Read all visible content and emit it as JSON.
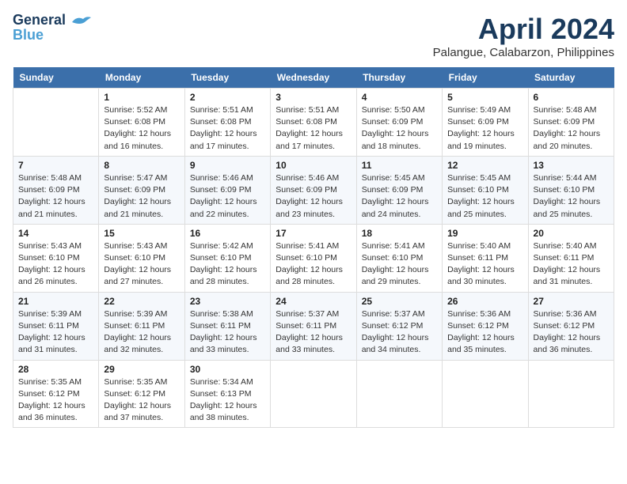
{
  "header": {
    "logo_line1": "General",
    "logo_line2": "Blue",
    "month": "April 2024",
    "location": "Palangue, Calabarzon, Philippines"
  },
  "weekdays": [
    "Sunday",
    "Monday",
    "Tuesday",
    "Wednesday",
    "Thursday",
    "Friday",
    "Saturday"
  ],
  "weeks": [
    [
      {
        "day": "",
        "sunrise": "",
        "sunset": "",
        "daylight": ""
      },
      {
        "day": "1",
        "sunrise": "Sunrise: 5:52 AM",
        "sunset": "Sunset: 6:08 PM",
        "daylight": "Daylight: 12 hours and 16 minutes."
      },
      {
        "day": "2",
        "sunrise": "Sunrise: 5:51 AM",
        "sunset": "Sunset: 6:08 PM",
        "daylight": "Daylight: 12 hours and 17 minutes."
      },
      {
        "day": "3",
        "sunrise": "Sunrise: 5:51 AM",
        "sunset": "Sunset: 6:08 PM",
        "daylight": "Daylight: 12 hours and 17 minutes."
      },
      {
        "day": "4",
        "sunrise": "Sunrise: 5:50 AM",
        "sunset": "Sunset: 6:09 PM",
        "daylight": "Daylight: 12 hours and 18 minutes."
      },
      {
        "day": "5",
        "sunrise": "Sunrise: 5:49 AM",
        "sunset": "Sunset: 6:09 PM",
        "daylight": "Daylight: 12 hours and 19 minutes."
      },
      {
        "day": "6",
        "sunrise": "Sunrise: 5:48 AM",
        "sunset": "Sunset: 6:09 PM",
        "daylight": "Daylight: 12 hours and 20 minutes."
      }
    ],
    [
      {
        "day": "7",
        "sunrise": "Sunrise: 5:48 AM",
        "sunset": "Sunset: 6:09 PM",
        "daylight": "Daylight: 12 hours and 21 minutes."
      },
      {
        "day": "8",
        "sunrise": "Sunrise: 5:47 AM",
        "sunset": "Sunset: 6:09 PM",
        "daylight": "Daylight: 12 hours and 21 minutes."
      },
      {
        "day": "9",
        "sunrise": "Sunrise: 5:46 AM",
        "sunset": "Sunset: 6:09 PM",
        "daylight": "Daylight: 12 hours and 22 minutes."
      },
      {
        "day": "10",
        "sunrise": "Sunrise: 5:46 AM",
        "sunset": "Sunset: 6:09 PM",
        "daylight": "Daylight: 12 hours and 23 minutes."
      },
      {
        "day": "11",
        "sunrise": "Sunrise: 5:45 AM",
        "sunset": "Sunset: 6:09 PM",
        "daylight": "Daylight: 12 hours and 24 minutes."
      },
      {
        "day": "12",
        "sunrise": "Sunrise: 5:45 AM",
        "sunset": "Sunset: 6:10 PM",
        "daylight": "Daylight: 12 hours and 25 minutes."
      },
      {
        "day": "13",
        "sunrise": "Sunrise: 5:44 AM",
        "sunset": "Sunset: 6:10 PM",
        "daylight": "Daylight: 12 hours and 25 minutes."
      }
    ],
    [
      {
        "day": "14",
        "sunrise": "Sunrise: 5:43 AM",
        "sunset": "Sunset: 6:10 PM",
        "daylight": "Daylight: 12 hours and 26 minutes."
      },
      {
        "day": "15",
        "sunrise": "Sunrise: 5:43 AM",
        "sunset": "Sunset: 6:10 PM",
        "daylight": "Daylight: 12 hours and 27 minutes."
      },
      {
        "day": "16",
        "sunrise": "Sunrise: 5:42 AM",
        "sunset": "Sunset: 6:10 PM",
        "daylight": "Daylight: 12 hours and 28 minutes."
      },
      {
        "day": "17",
        "sunrise": "Sunrise: 5:41 AM",
        "sunset": "Sunset: 6:10 PM",
        "daylight": "Daylight: 12 hours and 28 minutes."
      },
      {
        "day": "18",
        "sunrise": "Sunrise: 5:41 AM",
        "sunset": "Sunset: 6:10 PM",
        "daylight": "Daylight: 12 hours and 29 minutes."
      },
      {
        "day": "19",
        "sunrise": "Sunrise: 5:40 AM",
        "sunset": "Sunset: 6:11 PM",
        "daylight": "Daylight: 12 hours and 30 minutes."
      },
      {
        "day": "20",
        "sunrise": "Sunrise: 5:40 AM",
        "sunset": "Sunset: 6:11 PM",
        "daylight": "Daylight: 12 hours and 31 minutes."
      }
    ],
    [
      {
        "day": "21",
        "sunrise": "Sunrise: 5:39 AM",
        "sunset": "Sunset: 6:11 PM",
        "daylight": "Daylight: 12 hours and 31 minutes."
      },
      {
        "day": "22",
        "sunrise": "Sunrise: 5:39 AM",
        "sunset": "Sunset: 6:11 PM",
        "daylight": "Daylight: 12 hours and 32 minutes."
      },
      {
        "day": "23",
        "sunrise": "Sunrise: 5:38 AM",
        "sunset": "Sunset: 6:11 PM",
        "daylight": "Daylight: 12 hours and 33 minutes."
      },
      {
        "day": "24",
        "sunrise": "Sunrise: 5:37 AM",
        "sunset": "Sunset: 6:11 PM",
        "daylight": "Daylight: 12 hours and 33 minutes."
      },
      {
        "day": "25",
        "sunrise": "Sunrise: 5:37 AM",
        "sunset": "Sunset: 6:12 PM",
        "daylight": "Daylight: 12 hours and 34 minutes."
      },
      {
        "day": "26",
        "sunrise": "Sunrise: 5:36 AM",
        "sunset": "Sunset: 6:12 PM",
        "daylight": "Daylight: 12 hours and 35 minutes."
      },
      {
        "day": "27",
        "sunrise": "Sunrise: 5:36 AM",
        "sunset": "Sunset: 6:12 PM",
        "daylight": "Daylight: 12 hours and 36 minutes."
      }
    ],
    [
      {
        "day": "28",
        "sunrise": "Sunrise: 5:35 AM",
        "sunset": "Sunset: 6:12 PM",
        "daylight": "Daylight: 12 hours and 36 minutes."
      },
      {
        "day": "29",
        "sunrise": "Sunrise: 5:35 AM",
        "sunset": "Sunset: 6:12 PM",
        "daylight": "Daylight: 12 hours and 37 minutes."
      },
      {
        "day": "30",
        "sunrise": "Sunrise: 5:34 AM",
        "sunset": "Sunset: 6:13 PM",
        "daylight": "Daylight: 12 hours and 38 minutes."
      },
      {
        "day": "",
        "sunrise": "",
        "sunset": "",
        "daylight": ""
      },
      {
        "day": "",
        "sunrise": "",
        "sunset": "",
        "daylight": ""
      },
      {
        "day": "",
        "sunrise": "",
        "sunset": "",
        "daylight": ""
      },
      {
        "day": "",
        "sunrise": "",
        "sunset": "",
        "daylight": ""
      }
    ]
  ]
}
